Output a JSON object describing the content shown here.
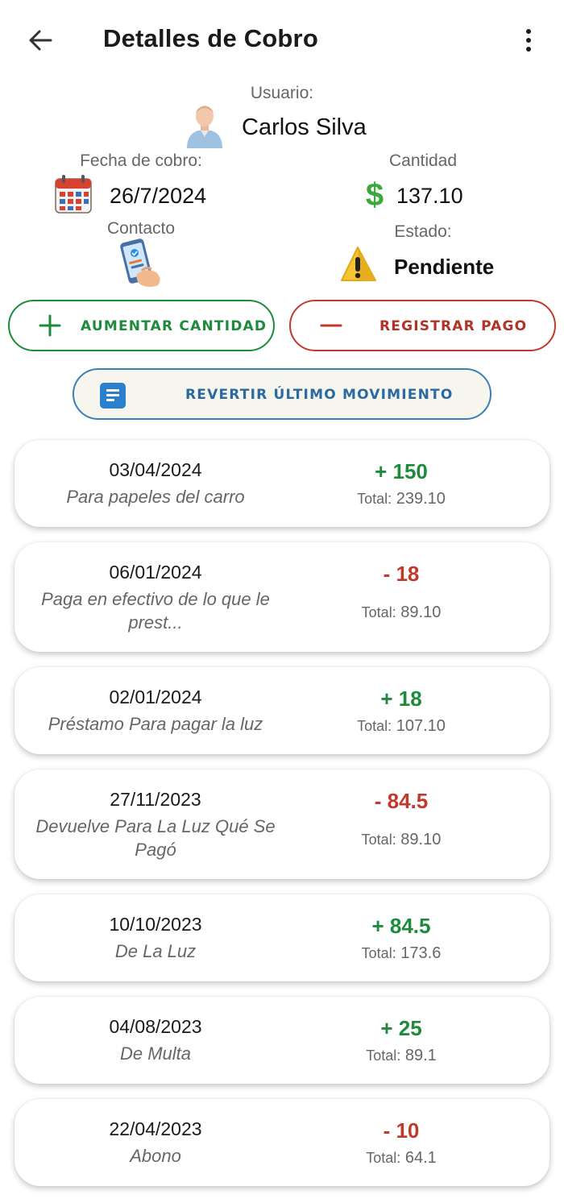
{
  "header": {
    "title": "Detalles de Cobro"
  },
  "user": {
    "label": "Usuario:",
    "name": "Carlos Silva"
  },
  "fecha": {
    "label": "Fecha de cobro:",
    "value": "26/7/2024"
  },
  "cantidad": {
    "label": "Cantidad",
    "value": "137.10"
  },
  "contacto": {
    "label": "Contacto"
  },
  "estado": {
    "label": "Estado:",
    "value": "Pendiente"
  },
  "actions": {
    "aumentar": "AUMENTAR CANTIDAD",
    "registrar": "REGISTRAR PAGO",
    "revertir": "REVERTIR ÚLTIMO MOVIMIENTO"
  },
  "total_label": "Total:",
  "colors": {
    "positive": "#1e8a3c",
    "negative": "#c0392b",
    "accent": "#2a7fcf"
  },
  "movements": [
    {
      "date": "03/04/2024",
      "desc": "Para papeles del carro",
      "amount": "+ 150",
      "sign": "pos",
      "total": "239.10"
    },
    {
      "date": "06/01/2024",
      "desc": "Paga en efectivo de lo que le prest...",
      "amount": "- 18",
      "sign": "neg",
      "total": "89.10"
    },
    {
      "date": "02/01/2024",
      "desc": "Préstamo Para pagar la luz",
      "amount": "+ 18",
      "sign": "pos",
      "total": "107.10"
    },
    {
      "date": "27/11/2023",
      "desc": "Devuelve Para La Luz Qué Se Pagó",
      "amount": "- 84.5",
      "sign": "neg",
      "total": "89.10"
    },
    {
      "date": "10/10/2023",
      "desc": "De La Luz",
      "amount": "+ 84.5",
      "sign": "pos",
      "total": "173.6"
    },
    {
      "date": "04/08/2023",
      "desc": "De Multa",
      "amount": "+ 25",
      "sign": "pos",
      "total": "89.1"
    },
    {
      "date": "22/04/2023",
      "desc": "Abono",
      "amount": "- 10",
      "sign": "neg",
      "total": "64.1"
    }
  ]
}
